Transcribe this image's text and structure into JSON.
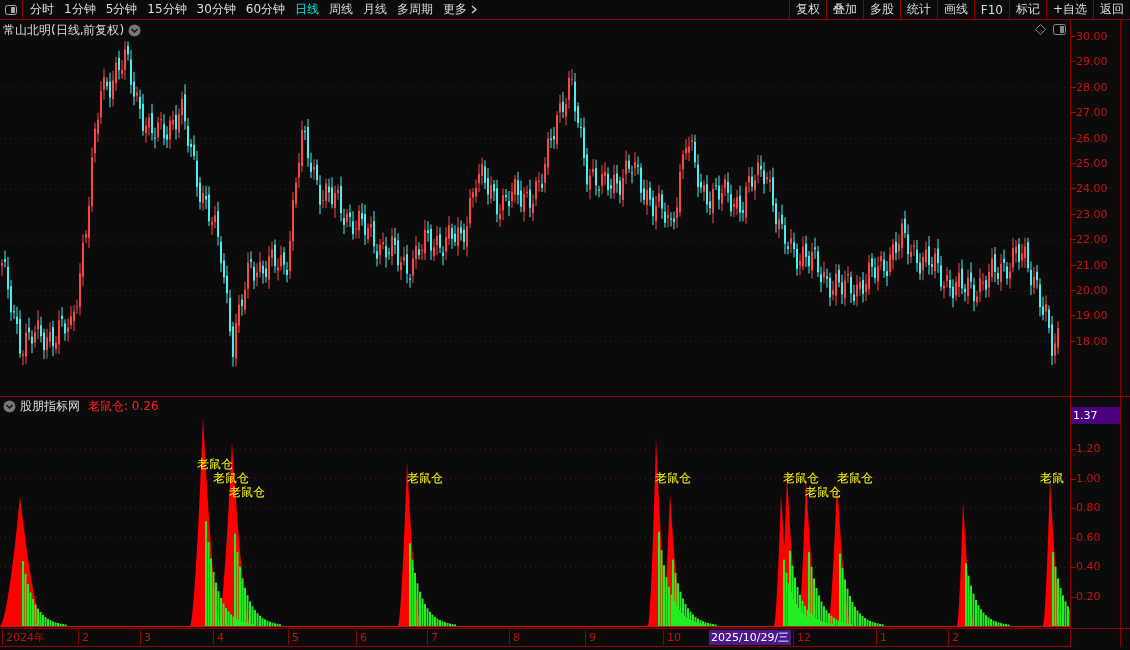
{
  "toolbar": {
    "periods": [
      {
        "label": "分时",
        "selected": false
      },
      {
        "label": "1分钟",
        "selected": false
      },
      {
        "label": "5分钟",
        "selected": false
      },
      {
        "label": "15分钟",
        "selected": false
      },
      {
        "label": "30分钟",
        "selected": false
      },
      {
        "label": "60分钟",
        "selected": false
      },
      {
        "label": "日线",
        "selected": true
      },
      {
        "label": "周线",
        "selected": false
      },
      {
        "label": "月线",
        "selected": false
      },
      {
        "label": "多周期",
        "selected": false
      },
      {
        "label": "更多",
        "selected": false
      }
    ],
    "actions": [
      "复权",
      "叠加",
      "多股",
      "统计",
      "画线",
      "F10",
      "标记",
      "+自选",
      "返回"
    ]
  },
  "price_pane": {
    "title": "常山北明(日线,前复权)",
    "y_axis": [
      "30.00",
      "29.00",
      "28.00",
      "27.00",
      "26.00",
      "25.00",
      "24.00",
      "23.00",
      "22.00",
      "21.00",
      "20.00",
      "19.00",
      "18.00"
    ]
  },
  "indicator_pane": {
    "name": "股朋指标网",
    "reading": "老鼠仓: 0.26",
    "cursor_value": "1.37",
    "y_axis": [
      "1.20",
      "1.00",
      "0.80",
      "0.60",
      "0.40",
      "0.20"
    ],
    "signals": [
      {
        "label": "老鼠仓"
      },
      {
        "label": "老鼠仓"
      },
      {
        "label": "老鼠仓"
      },
      {
        "label": "老鼠仓"
      },
      {
        "label": "老鼠仓"
      },
      {
        "label": "老鼠仓"
      },
      {
        "label": "老鼠仓"
      },
      {
        "label": "老鼠仓"
      },
      {
        "label": "老鼠"
      }
    ]
  },
  "date_axis": {
    "labels": [
      "2024年",
      "2",
      "3",
      "4",
      "5",
      "6",
      "7",
      "8",
      "9",
      "10",
      "12",
      "1",
      "2"
    ],
    "cursor_date": "2025/10/29/三"
  }
}
